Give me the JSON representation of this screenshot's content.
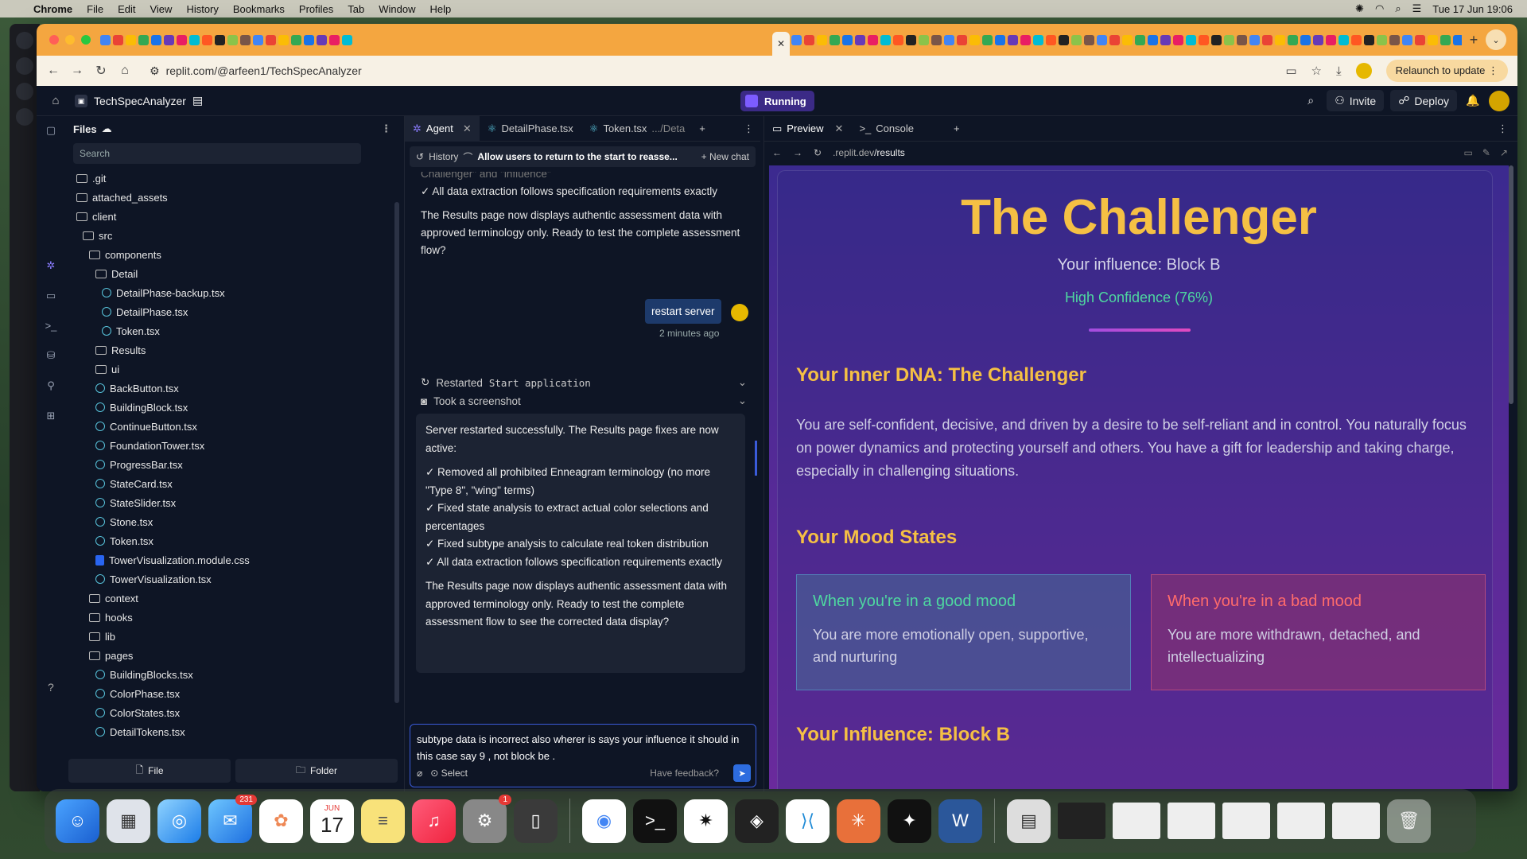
{
  "menubar": {
    "app": "Chrome",
    "items": [
      "File",
      "Edit",
      "View",
      "History",
      "Bookmarks",
      "Profiles",
      "Tab",
      "Window",
      "Help"
    ],
    "datetime": "Tue 17 Jun  19:06"
  },
  "browser": {
    "url_host": "replit.com",
    "url_path": "/@arfeen1/TechSpecAnalyzer",
    "relaunch_label": "Relaunch to update",
    "tab_close": "✕",
    "tab_plus": "+"
  },
  "replit": {
    "project_name": "TechSpecAnalyzer",
    "status": "Running",
    "invite_label": "Invite",
    "deploy_label": "Deploy"
  },
  "files": {
    "title": "Files",
    "search_placeholder": "Search",
    "tree": [
      {
        "name": ".git",
        "type": "folder",
        "depth": 0
      },
      {
        "name": "attached_assets",
        "type": "folder",
        "depth": 0
      },
      {
        "name": "client",
        "type": "folder",
        "depth": 0
      },
      {
        "name": "src",
        "type": "folder",
        "depth": 1
      },
      {
        "name": "components",
        "type": "folder",
        "depth": 2
      },
      {
        "name": "Detail",
        "type": "folder",
        "depth": 3
      },
      {
        "name": "DetailPhase-backup.tsx",
        "type": "react",
        "depth": 4
      },
      {
        "name": "DetailPhase.tsx",
        "type": "react",
        "depth": 4
      },
      {
        "name": "Token.tsx",
        "type": "react",
        "depth": 4
      },
      {
        "name": "Results",
        "type": "folder",
        "depth": 3
      },
      {
        "name": "ui",
        "type": "folder",
        "depth": 3
      },
      {
        "name": "BackButton.tsx",
        "type": "react",
        "depth": 3
      },
      {
        "name": "BuildingBlock.tsx",
        "type": "react",
        "depth": 3
      },
      {
        "name": "ContinueButton.tsx",
        "type": "react",
        "depth": 3
      },
      {
        "name": "FoundationTower.tsx",
        "type": "react",
        "depth": 3
      },
      {
        "name": "ProgressBar.tsx",
        "type": "react",
        "depth": 3
      },
      {
        "name": "StateCard.tsx",
        "type": "react",
        "depth": 3
      },
      {
        "name": "StateSlider.tsx",
        "type": "react",
        "depth": 3
      },
      {
        "name": "Stone.tsx",
        "type": "react",
        "depth": 3
      },
      {
        "name": "Token.tsx",
        "type": "react",
        "depth": 3
      },
      {
        "name": "TowerVisualization.module.css",
        "type": "css",
        "depth": 3
      },
      {
        "name": "TowerVisualization.tsx",
        "type": "react",
        "depth": 3
      },
      {
        "name": "context",
        "type": "folder",
        "depth": 2
      },
      {
        "name": "hooks",
        "type": "folder",
        "depth": 2
      },
      {
        "name": "lib",
        "type": "folder",
        "depth": 2
      },
      {
        "name": "pages",
        "type": "folder",
        "depth": 2
      },
      {
        "name": "BuildingBlocks.tsx",
        "type": "react",
        "depth": 3
      },
      {
        "name": "ColorPhase.tsx",
        "type": "react",
        "depth": 3
      },
      {
        "name": "ColorStates.tsx",
        "type": "react",
        "depth": 3
      },
      {
        "name": "DetailTokens.tsx",
        "type": "react",
        "depth": 3
      }
    ],
    "new_file_label": "File",
    "new_folder_label": "Folder"
  },
  "agent": {
    "tabs": [
      "Agent",
      "DetailPhase.tsx",
      "Token.tsx"
    ],
    "tab3_path": ".../Deta",
    "history_label": "History",
    "thread_title": "Allow users to return to the start to reasse...",
    "new_chat_label": "New chat",
    "prev_fade": "Challenger\" and \"influence\"",
    "prev_line": "✓ All data extraction follows specification requirements exactly",
    "prev_para": "The Results page now displays authentic assessment data with approved terminology only. Ready to test the complete assessment flow?",
    "user_msg": "restart server",
    "user_time": "2 minutes ago",
    "action1_prefix": "Restarted",
    "action1_code": "Start application",
    "action2": "Took a screenshot",
    "reply_intro": "Server restarted successfully. The Results page fixes are now active:",
    "reply_items": [
      "✓ Removed all prohibited Enneagram terminology (no more \"Type 8\", \"wing\" terms)",
      "✓ Fixed state analysis to extract actual color selections and percentages",
      "✓ Fixed subtype analysis to calculate real token distribution",
      "✓ All data extraction follows specification requirements exactly"
    ],
    "reply_outro": "The Results page now displays authentic assessment data with approved terminology only. Ready to test the complete assessment flow to see the corrected data display?",
    "input_value": "subtype data is incorrect  also wherer is says your influence it should in this case say 9 , not block be .",
    "select_label": "Select",
    "feedback_label": "Have feedback?"
  },
  "preview": {
    "tabs": [
      "Preview",
      "Console"
    ],
    "url_prefix": ".replit.dev",
    "url_path": "/results",
    "title": "The Challenger",
    "influence": "Your influence: Block B",
    "confidence": "High Confidence (76%)",
    "dna_heading": "Your Inner DNA: The Challenger",
    "dna_text": "You are self-confident, decisive, and driven by a desire to be self-reliant and in control. You naturally focus on power dynamics and protecting yourself and others. You have a gift for leadership and taking charge, especially in challenging situations.",
    "mood_heading": "Your Mood States",
    "good_title": "When you're in a good mood",
    "good_text": "You are more emotionally open, supportive, and nurturing",
    "bad_title": "When you're in a bad mood",
    "bad_text": "You are more withdrawn, detached, and intellectualizing",
    "influence_heading": "Your Influence: Block B"
  },
  "dock": {
    "mail_badge": "231",
    "settings_badge": "1",
    "calendar_month": "JUN",
    "calendar_day": "17"
  }
}
